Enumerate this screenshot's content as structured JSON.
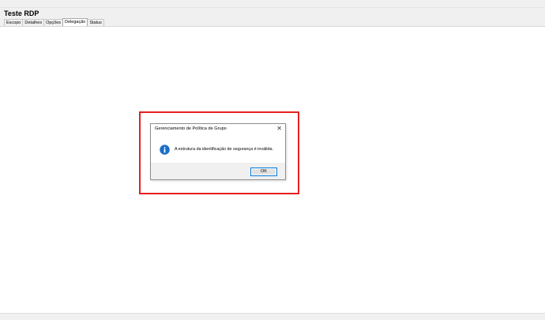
{
  "window": {
    "title": "Teste RDP"
  },
  "tabs": [
    {
      "label": "Escopo"
    },
    {
      "label": "Detalhes"
    },
    {
      "label": "Opções"
    },
    {
      "label": "Delegação"
    },
    {
      "label": "Status"
    }
  ],
  "active_tab": "Delegação",
  "dialog": {
    "title": "Gerenciamento de Política de Grupo",
    "close_glyph": "✕",
    "message": "A estrutura da identificação de segurança é inválida.",
    "ok_label": "OK",
    "icon": "info-icon"
  },
  "colors": {
    "highlight": "#e5201f",
    "info_icon": "#1a6fc9",
    "focus_border": "#0078d7"
  }
}
